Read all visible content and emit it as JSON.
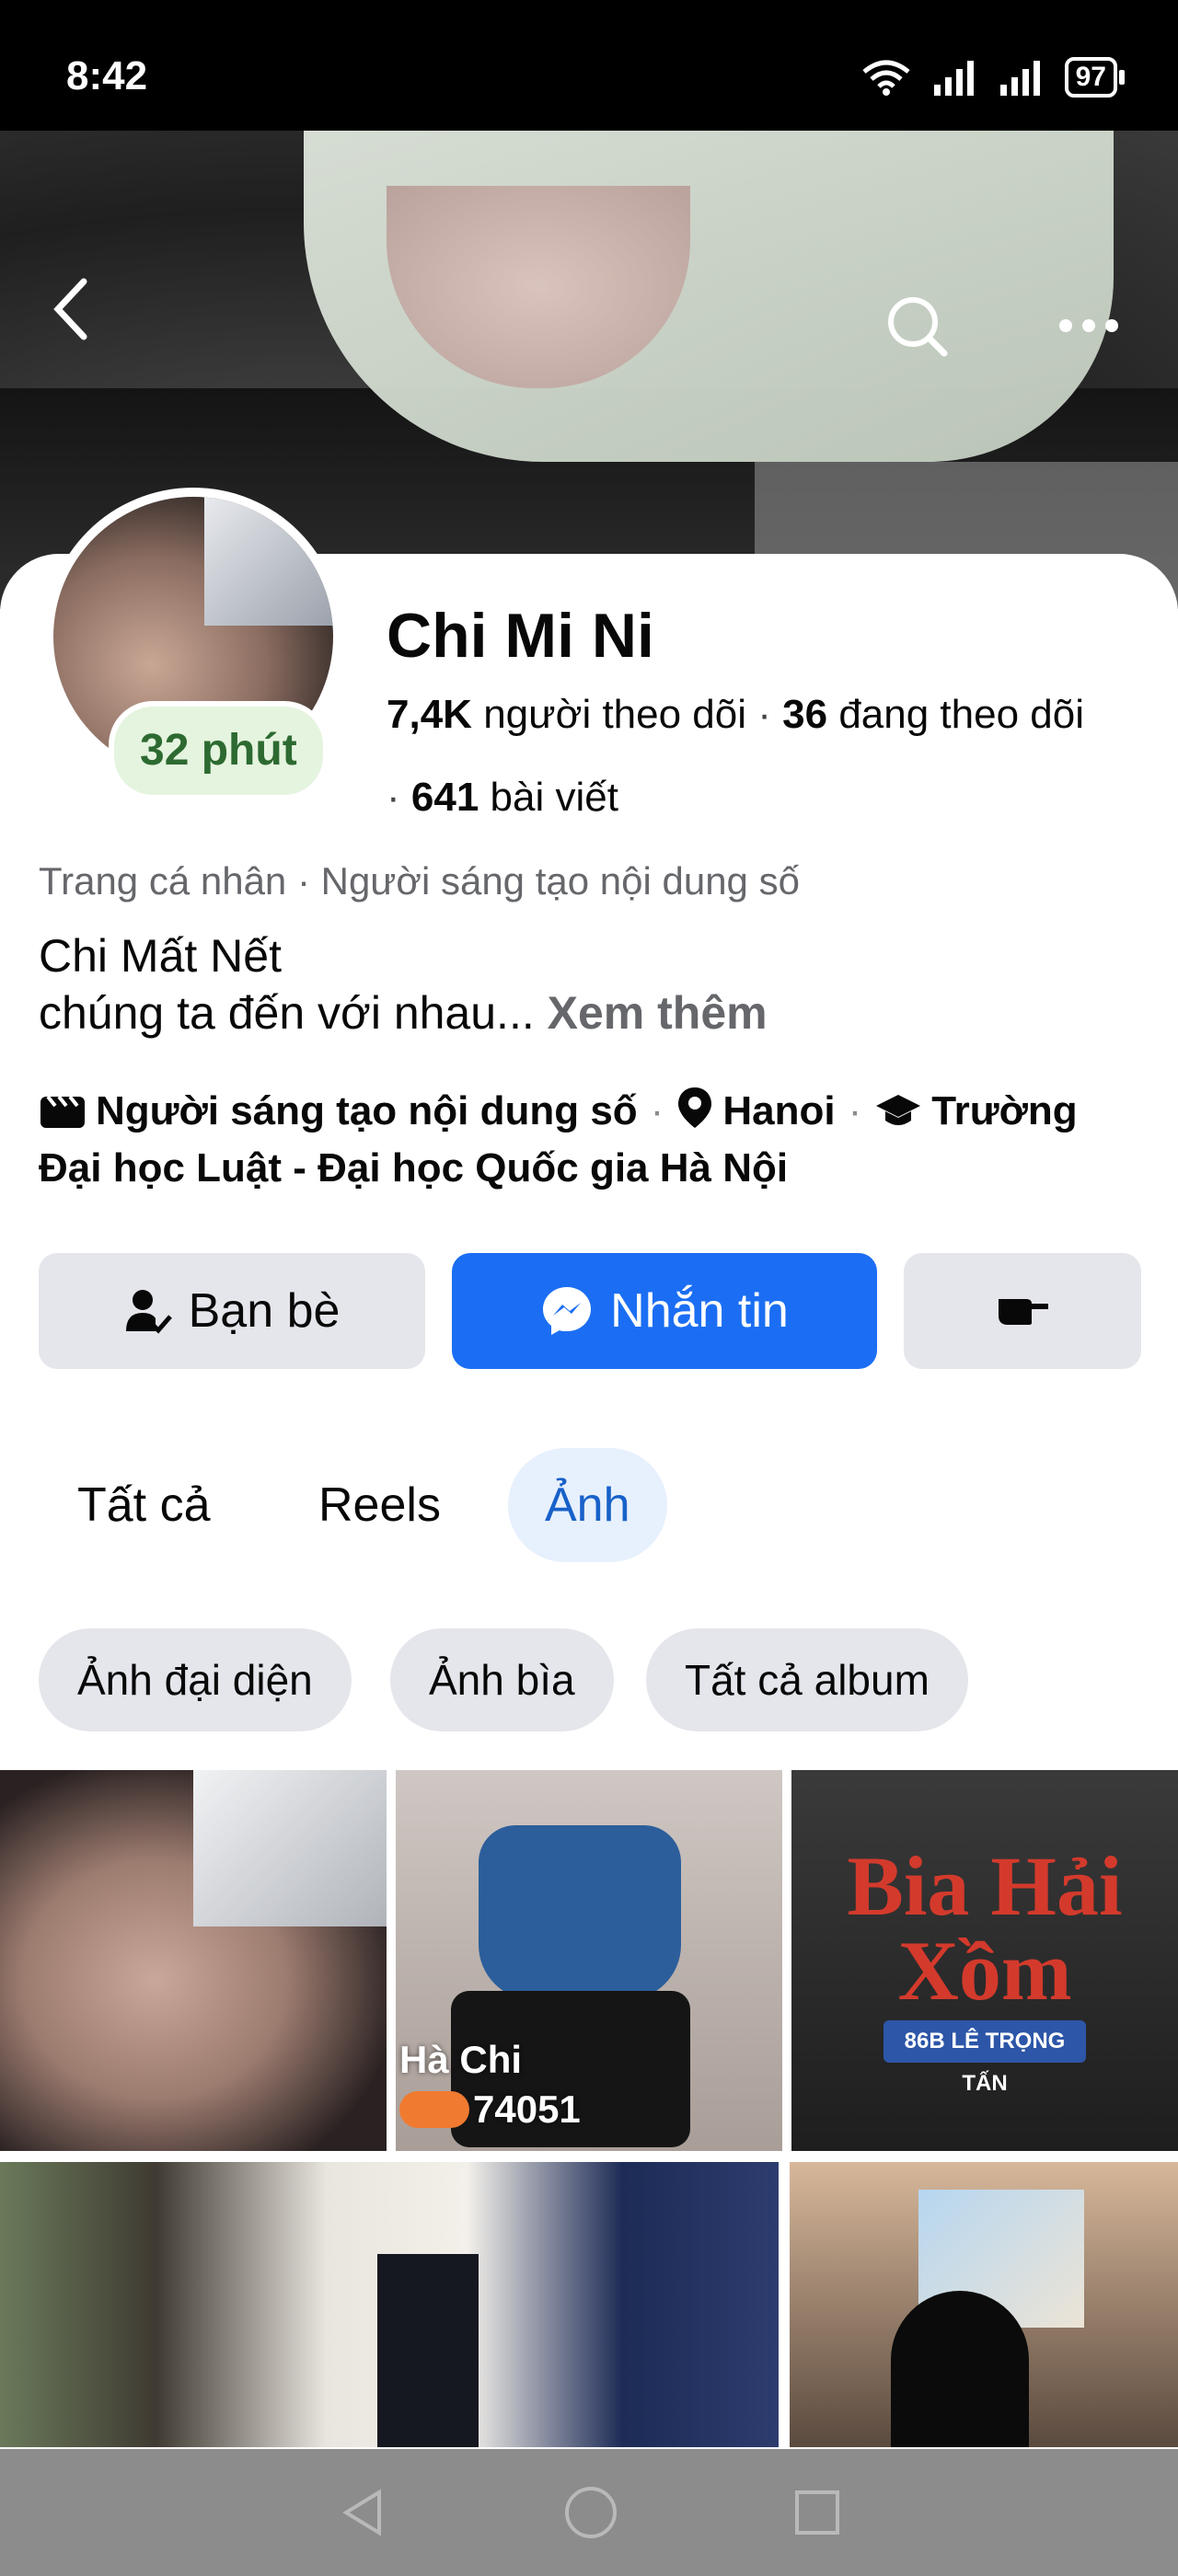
{
  "status_bar": {
    "time": "8:42",
    "battery": "97"
  },
  "profile": {
    "name": "Chi Mi Ni",
    "story_badge": "32 phút",
    "followers_count": "7,4K",
    "followers_label": "người theo dõi",
    "following_count": "36",
    "following_label": "đang theo dõi",
    "posts_count": "641",
    "posts_label": "bài viết",
    "category": "Trang cá nhân · Người sáng tạo nội dung số",
    "bio_line1": "Chi Mất Nết",
    "bio_line2": "chúng ta đến với nhau...",
    "see_more": "Xem thêm",
    "details": {
      "role": "Người sáng tạo nội dung số",
      "location": "Hanoi",
      "school": "Trường Đại học Luật - Đại học Quốc gia Hà Nội"
    }
  },
  "actions": {
    "friends": "Bạn bè",
    "message": "Nhắn tin"
  },
  "tabs": [
    {
      "label": "Tất cả",
      "active": false
    },
    {
      "label": "Reels",
      "active": false
    },
    {
      "label": "Ảnh",
      "active": true
    }
  ],
  "chips": [
    "Ảnh đại diện",
    "Ảnh bìa",
    "Tất cả album"
  ],
  "photos": {
    "p2_caption_line1": "Hà Chi",
    "p2_caption_line2": "74051",
    "p3_sign": "Bia Hải Xồm",
    "p3_plate": "86B LÊ TRỌNG TẤN"
  },
  "icons": [
    "back-icon",
    "search-icon",
    "more-icon",
    "clapperboard-icon",
    "location-pin-icon",
    "graduation-cap-icon",
    "friend-check-icon",
    "messenger-icon",
    "poke-hand-icon"
  ],
  "colors": {
    "primary": "#1B6EF3",
    "active_tab_bg": "#E7F0FD",
    "active_tab_text": "#1861C9",
    "story_badge_bg": "#E5F4DF",
    "story_badge_text": "#2D6A31"
  }
}
